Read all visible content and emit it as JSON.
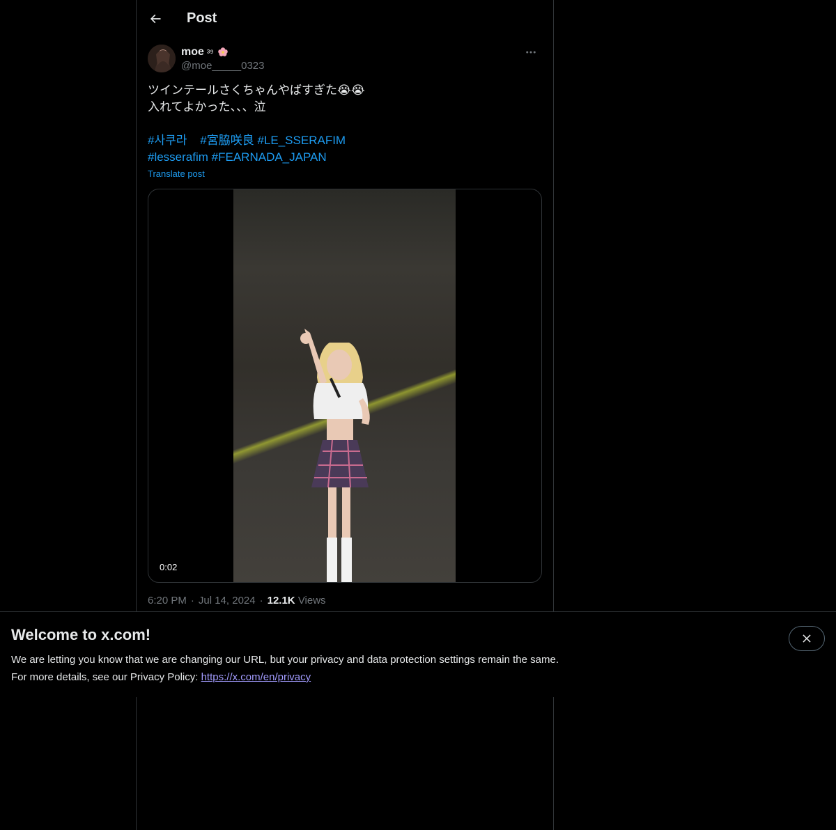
{
  "header": {
    "title": "Post"
  },
  "post": {
    "author": {
      "name": "moe",
      "name_suffix": "³⁹",
      "handle": "@moe_____0323"
    },
    "text_lines": [
      "ツインテールさくちゃんやばすぎた😭😭",
      "入れてよかった、、、泣"
    ],
    "hashtags_line1": [
      "#사쿠라",
      "#宮脇咲良",
      "#LE_SSERAFIM"
    ],
    "hashtags_line2": [
      "#lesserafim",
      "#FEARNADA_JAPAN"
    ],
    "translate_label": "Translate post",
    "video_duration": "0:02",
    "time": "6:20 PM",
    "date": "Jul 14, 2024",
    "views_count": "12.1K",
    "views_label": "Views",
    "separator": "·"
  },
  "banner": {
    "title": "Welcome to x.com!",
    "line1": "We are letting you know that we are changing our URL, but your privacy and data protection settings remain the same.",
    "line2_prefix": "For more details, see our Privacy Policy: ",
    "link_text": "https://x.com/en/privacy"
  },
  "colors": {
    "background": "#000000",
    "text": "#e7e9ea",
    "secondary": "#71767b",
    "accent": "#1d9bf0",
    "border": "#2f3336"
  }
}
